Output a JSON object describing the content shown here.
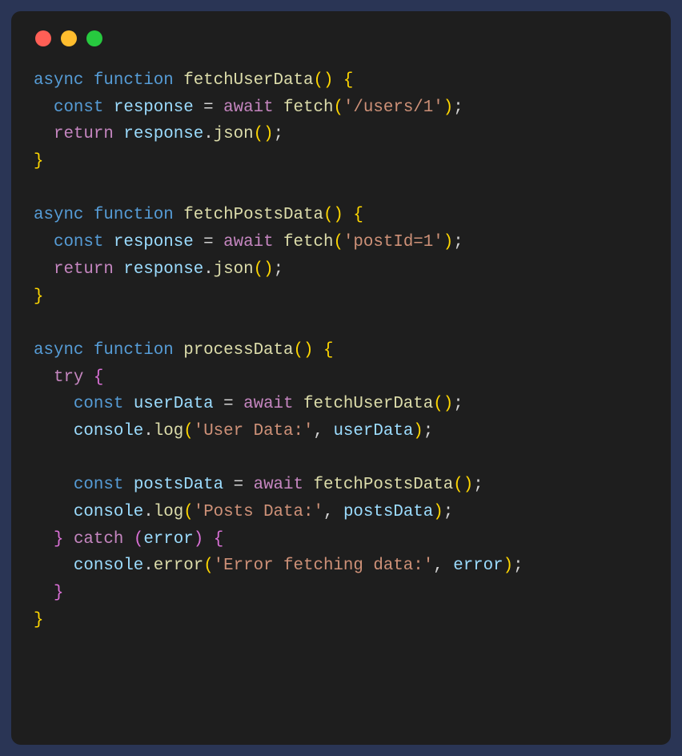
{
  "traffic_lights": {
    "red": "#ff5f56",
    "yellow": "#ffbd2e",
    "green": "#27c93f"
  },
  "code": {
    "lines": [
      {
        "tokens": [
          [
            "kw-async",
            "async"
          ],
          [
            "punct",
            " "
          ],
          [
            "kw-function",
            "function"
          ],
          [
            "punct",
            " "
          ],
          [
            "fn-name",
            "fetchUserData"
          ],
          [
            "paren",
            "()"
          ],
          [
            "punct",
            " "
          ],
          [
            "brace",
            "{"
          ]
        ]
      },
      {
        "tokens": [
          [
            "punct",
            "  "
          ],
          [
            "kw-const",
            "const"
          ],
          [
            "punct",
            " "
          ],
          [
            "var-name",
            "response"
          ],
          [
            "punct",
            " = "
          ],
          [
            "kw-await",
            "await"
          ],
          [
            "punct",
            " "
          ],
          [
            "fn-call",
            "fetch"
          ],
          [
            "paren",
            "("
          ],
          [
            "str",
            "'/users/1'"
          ],
          [
            "paren",
            ")"
          ],
          [
            "punct",
            ";"
          ]
        ]
      },
      {
        "tokens": [
          [
            "punct",
            "  "
          ],
          [
            "kw-return",
            "return"
          ],
          [
            "punct",
            " "
          ],
          [
            "obj-name",
            "response"
          ],
          [
            "punct",
            "."
          ],
          [
            "fn-call",
            "json"
          ],
          [
            "paren",
            "()"
          ],
          [
            "punct",
            ";"
          ]
        ]
      },
      {
        "tokens": [
          [
            "brace",
            "}"
          ]
        ]
      },
      {
        "tokens": [
          [
            "punct",
            ""
          ]
        ]
      },
      {
        "tokens": [
          [
            "kw-async",
            "async"
          ],
          [
            "punct",
            " "
          ],
          [
            "kw-function",
            "function"
          ],
          [
            "punct",
            " "
          ],
          [
            "fn-name",
            "fetchPostsData"
          ],
          [
            "paren",
            "()"
          ],
          [
            "punct",
            " "
          ],
          [
            "brace",
            "{"
          ]
        ]
      },
      {
        "tokens": [
          [
            "punct",
            "  "
          ],
          [
            "kw-const",
            "const"
          ],
          [
            "punct",
            " "
          ],
          [
            "var-name",
            "response"
          ],
          [
            "punct",
            " = "
          ],
          [
            "kw-await",
            "await"
          ],
          [
            "punct",
            " "
          ],
          [
            "fn-call",
            "fetch"
          ],
          [
            "paren",
            "("
          ],
          [
            "str",
            "'postId=1'"
          ],
          [
            "paren",
            ")"
          ],
          [
            "punct",
            ";"
          ]
        ]
      },
      {
        "tokens": [
          [
            "punct",
            "  "
          ],
          [
            "kw-return",
            "return"
          ],
          [
            "punct",
            " "
          ],
          [
            "obj-name",
            "response"
          ],
          [
            "punct",
            "."
          ],
          [
            "fn-call",
            "json"
          ],
          [
            "paren",
            "()"
          ],
          [
            "punct",
            ";"
          ]
        ]
      },
      {
        "tokens": [
          [
            "brace",
            "}"
          ]
        ]
      },
      {
        "tokens": [
          [
            "punct",
            ""
          ]
        ]
      },
      {
        "tokens": [
          [
            "kw-async",
            "async"
          ],
          [
            "punct",
            " "
          ],
          [
            "kw-function",
            "function"
          ],
          [
            "punct",
            " "
          ],
          [
            "fn-name",
            "processData"
          ],
          [
            "paren",
            "()"
          ],
          [
            "punct",
            " "
          ],
          [
            "brace",
            "{"
          ]
        ]
      },
      {
        "tokens": [
          [
            "punct",
            "  "
          ],
          [
            "kw-try",
            "try"
          ],
          [
            "punct",
            " "
          ],
          [
            "paren2",
            "{"
          ]
        ]
      },
      {
        "tokens": [
          [
            "punct",
            "    "
          ],
          [
            "kw-const",
            "const"
          ],
          [
            "punct",
            " "
          ],
          [
            "var-name",
            "userData"
          ],
          [
            "punct",
            " = "
          ],
          [
            "kw-await",
            "await"
          ],
          [
            "punct",
            " "
          ],
          [
            "fn-call",
            "fetchUserData"
          ],
          [
            "paren",
            "()"
          ],
          [
            "punct",
            ";"
          ]
        ]
      },
      {
        "tokens": [
          [
            "punct",
            "    "
          ],
          [
            "obj-name",
            "console"
          ],
          [
            "punct",
            "."
          ],
          [
            "fn-call",
            "log"
          ],
          [
            "paren",
            "("
          ],
          [
            "str",
            "'User Data:'"
          ],
          [
            "punct",
            ", "
          ],
          [
            "var-name",
            "userData"
          ],
          [
            "paren",
            ")"
          ],
          [
            "punct",
            ";"
          ]
        ]
      },
      {
        "tokens": [
          [
            "punct",
            ""
          ]
        ]
      },
      {
        "tokens": [
          [
            "punct",
            "    "
          ],
          [
            "kw-const",
            "const"
          ],
          [
            "punct",
            " "
          ],
          [
            "var-name",
            "postsData"
          ],
          [
            "punct",
            " = "
          ],
          [
            "kw-await",
            "await"
          ],
          [
            "punct",
            " "
          ],
          [
            "fn-call",
            "fetchPostsData"
          ],
          [
            "paren",
            "()"
          ],
          [
            "punct",
            ";"
          ]
        ]
      },
      {
        "tokens": [
          [
            "punct",
            "    "
          ],
          [
            "obj-name",
            "console"
          ],
          [
            "punct",
            "."
          ],
          [
            "fn-call",
            "log"
          ],
          [
            "paren",
            "("
          ],
          [
            "str",
            "'Posts Data:'"
          ],
          [
            "punct",
            ", "
          ],
          [
            "var-name",
            "postsData"
          ],
          [
            "paren",
            ")"
          ],
          [
            "punct",
            ";"
          ]
        ]
      },
      {
        "tokens": [
          [
            "punct",
            "  "
          ],
          [
            "paren2",
            "}"
          ],
          [
            "punct",
            " "
          ],
          [
            "kw-catch",
            "catch"
          ],
          [
            "punct",
            " "
          ],
          [
            "paren2",
            "("
          ],
          [
            "var-name",
            "error"
          ],
          [
            "paren2",
            ")"
          ],
          [
            "punct",
            " "
          ],
          [
            "paren2",
            "{"
          ]
        ]
      },
      {
        "tokens": [
          [
            "punct",
            "    "
          ],
          [
            "obj-name",
            "console"
          ],
          [
            "punct",
            "."
          ],
          [
            "fn-call",
            "error"
          ],
          [
            "paren",
            "("
          ],
          [
            "str",
            "'Error fetching data:'"
          ],
          [
            "punct",
            ", "
          ],
          [
            "var-name",
            "error"
          ],
          [
            "paren",
            ")"
          ],
          [
            "punct",
            ";"
          ]
        ]
      },
      {
        "tokens": [
          [
            "punct",
            "  "
          ],
          [
            "paren2",
            "}"
          ]
        ]
      },
      {
        "tokens": [
          [
            "brace",
            "}"
          ]
        ]
      }
    ]
  }
}
